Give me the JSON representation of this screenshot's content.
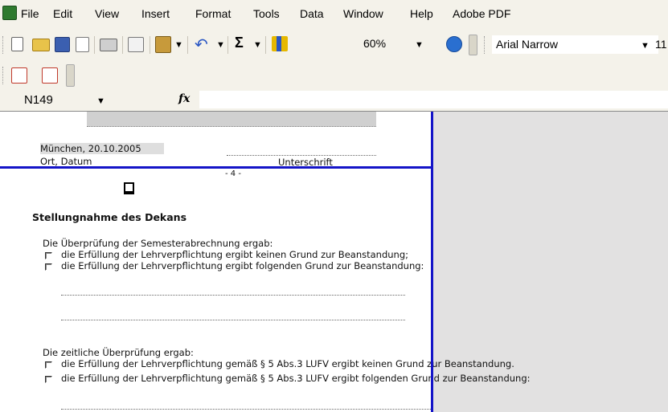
{
  "menu": {
    "items": [
      "File",
      "Edit",
      "View",
      "Insert",
      "Format",
      "Tools",
      "Data",
      "Window",
      "Help",
      "Adobe PDF"
    ]
  },
  "toolbar": {
    "zoom": "60%",
    "font_name": "Arial Narrow",
    "font_size": "11",
    "sum_symbol": "Σ"
  },
  "formula_bar": {
    "name_box": "N149",
    "fx": "fx",
    "formula": ""
  },
  "sheet": {
    "place_date_value": "München, 20.10.2005",
    "place_date_label": "Ort, Datum",
    "signature_label": "Unterschrift",
    "page_number": "- 4 -",
    "heading": "Stellungnahme des Dekans",
    "check1_title": "Die Überprüfung der Semesterabrechnung ergab:",
    "check1_options": [
      "die Erfüllung der Lehrverpflichtung ergibt keinen Grund zur Beanstandung;",
      "die Erfüllung der Lehrverpflichtung ergibt folgenden Grund zur Beanstandung:"
    ],
    "check2_title": "Die  zeitliche Überprüfung ergab:",
    "check2_options": [
      "die Erfüllung der Lehrverpflichtung gemäß § 5 Abs.3 LUFV ergibt keinen Grund zur Beanstandung.",
      "die Erfüllung der Lehrverpflichtung gemäß § 5 Abs.3 LUFV ergibt folgenden Grund zur Beanstandung:"
    ]
  }
}
